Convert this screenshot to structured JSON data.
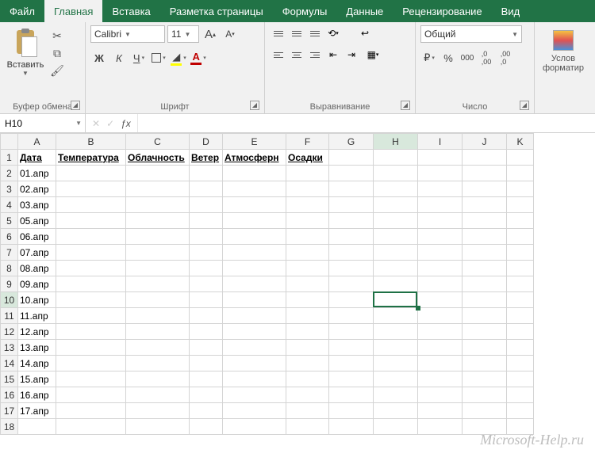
{
  "tabs": [
    "Файл",
    "Главная",
    "Вставка",
    "Разметка страницы",
    "Формулы",
    "Данные",
    "Рецензирование",
    "Вид"
  ],
  "active_tab_index": 1,
  "ribbon": {
    "clipboard": {
      "paste": "Вставить",
      "label": "Буфер обмена"
    },
    "font": {
      "name": "Calibri",
      "size": "11",
      "increase": "A",
      "decrease": "A",
      "bold": "Ж",
      "italic": "К",
      "underline": "Ч",
      "label": "Шрифт"
    },
    "alignment": {
      "label": "Выравнивание"
    },
    "number": {
      "format": "Общий",
      "label": "Число"
    },
    "cf": {
      "line1": "Услов",
      "line2": "форматир"
    }
  },
  "namebox": "H10",
  "fx": "ƒx",
  "columns": [
    {
      "letter": "A",
      "width": 48
    },
    {
      "letter": "B",
      "width": 88
    },
    {
      "letter": "C",
      "width": 80
    },
    {
      "letter": "D",
      "width": 42
    },
    {
      "letter": "E",
      "width": 80
    },
    {
      "letter": "F",
      "width": 54
    },
    {
      "letter": "G",
      "width": 56
    },
    {
      "letter": "H",
      "width": 56
    },
    {
      "letter": "I",
      "width": 56
    },
    {
      "letter": "J",
      "width": 56
    },
    {
      "letter": "K",
      "width": 34
    }
  ],
  "selected_col": "H",
  "selected_row": 10,
  "header_row": [
    "Дата",
    "Температура",
    "Облачность",
    "Ветер",
    "Атмосферн",
    "Осадки"
  ],
  "date_rows": [
    "01.апр",
    "02.апр",
    "03.апр",
    "05.апр",
    "06.апр",
    "07.апр",
    "08.апр",
    "09.апр",
    "10.апр",
    "11.апр",
    "12.апр",
    "13.апр",
    "14.апр",
    "15.апр",
    "16.апр",
    "17.апр"
  ],
  "total_rows": 18,
  "watermark": "Microsoft-Help.ru"
}
